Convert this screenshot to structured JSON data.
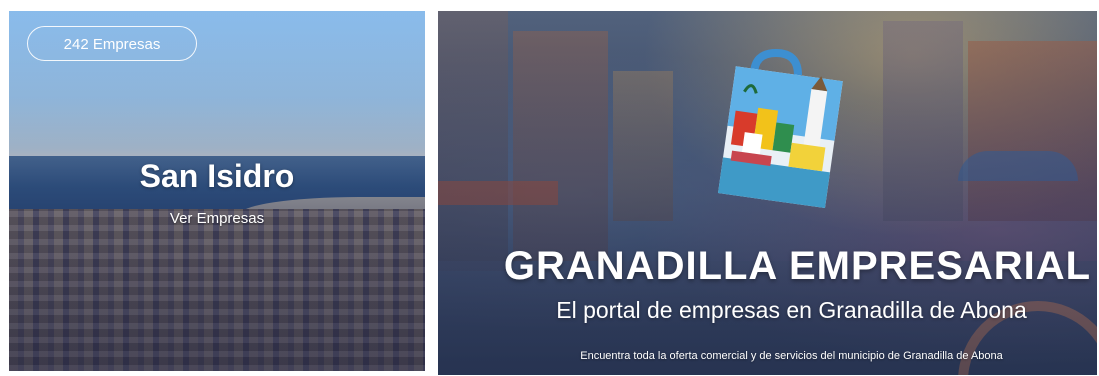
{
  "municipality_card": {
    "count_badge": "242 Empresas",
    "title": "San Isidro",
    "link_label": "Ver Empresas"
  },
  "hero_banner": {
    "title": "GRANADILLA EMPRESARIAL",
    "subtitle": "El portal de empresas en Granadilla de Abona",
    "description": "Encuentra toda la oferta comercial y de servicios del municipio de Granadilla de Abona"
  },
  "colors": {
    "sky": "#8fc3f4",
    "sea": "#2f5587",
    "banner_overlay": "#3d4c6c",
    "text": "#ffffff"
  }
}
